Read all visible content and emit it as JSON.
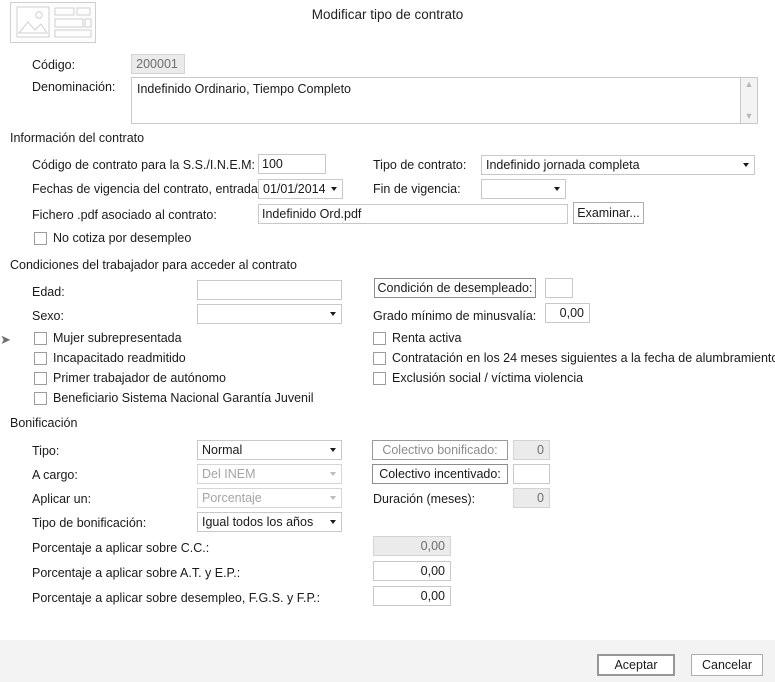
{
  "header": {
    "title": "Modificar tipo de contrato",
    "icon": "image-placeholder-icon"
  },
  "top_fields": {
    "codigo_label": "Código:",
    "codigo_value": "200001",
    "denominacion_label": "Denominación:",
    "denominacion_value": "Indefinido Ordinario, Tiempo Completo"
  },
  "contract_info": {
    "section_title": "Información del contrato",
    "codigo_ss_label": "Código de contrato para la S.S./I.N.E.M:",
    "codigo_ss_value": "100",
    "tipo_contrato_label": "Tipo de contrato:",
    "tipo_contrato_value": "Indefinido jornada completa",
    "fechas_label": "Fechas de vigencia del contrato, entrada:",
    "fechas_value": "01/01/2014",
    "fin_vigencia_label": "Fin de vigencia:",
    "fin_vigencia_value": "",
    "fichero_label": "Fichero .pdf asociado al contrato:",
    "fichero_value": "Indefinido Ord.pdf",
    "examinar_label": "Examinar...",
    "no_cotiza_label": "No cotiza por desempleo"
  },
  "worker_conditions": {
    "section_title": "Condiciones del trabajador para acceder al contrato",
    "edad_label": "Edad:",
    "edad_value": "",
    "sexo_label": "Sexo:",
    "sexo_value": "",
    "condicion_desempleado_label": "Condición de desempleado:",
    "condicion_desempleado_value": "",
    "grado_minusvalia_label": "Grado mínimo de minusvalía:",
    "grado_minusvalia_value": "0,00",
    "checkboxes_left": [
      "Mujer subrepresentada",
      "Incapacitado readmitido",
      "Primer trabajador de autónomo",
      "Beneficiario Sistema Nacional Garantía Juvenil"
    ],
    "checkboxes_right": [
      "Renta activa",
      "Contratación en los 24 meses siguientes a la fecha de alumbramiento",
      "Exclusión social  / víctima violencia"
    ]
  },
  "bonificacion": {
    "section_title": "Bonificación",
    "tipo_label": "Tipo:",
    "tipo_value": "Normal",
    "a_cargo_label": "A cargo:",
    "a_cargo_value": "Del INEM",
    "aplicar_un_label": "Aplicar un:",
    "aplicar_un_value": "Porcentaje",
    "tipo_bonificacion_label": "Tipo de bonificación:",
    "tipo_bonificacion_value": "Igual todos los años",
    "colectivo_bonificado_label": "Colectivo bonificado:",
    "colectivo_bonificado_value": "0",
    "colectivo_incentivado_label": "Colectivo incentivado:",
    "colectivo_incentivado_value": "",
    "duracion_label": "Duración (meses):",
    "duracion_value": "0",
    "pct_cc_label": "Porcentaje a aplicar sobre C.C.:",
    "pct_cc_value": "0,00",
    "pct_at_label": "Porcentaje a aplicar sobre A.T. y E.P.:",
    "pct_at_value": "0,00",
    "pct_desempleo_label": "Porcentaje a aplicar sobre desempleo, F.G.S. y F.P.:",
    "pct_desempleo_value": "0,00"
  },
  "footer": {
    "accept_label": "Aceptar",
    "cancel_label": "Cancelar"
  }
}
